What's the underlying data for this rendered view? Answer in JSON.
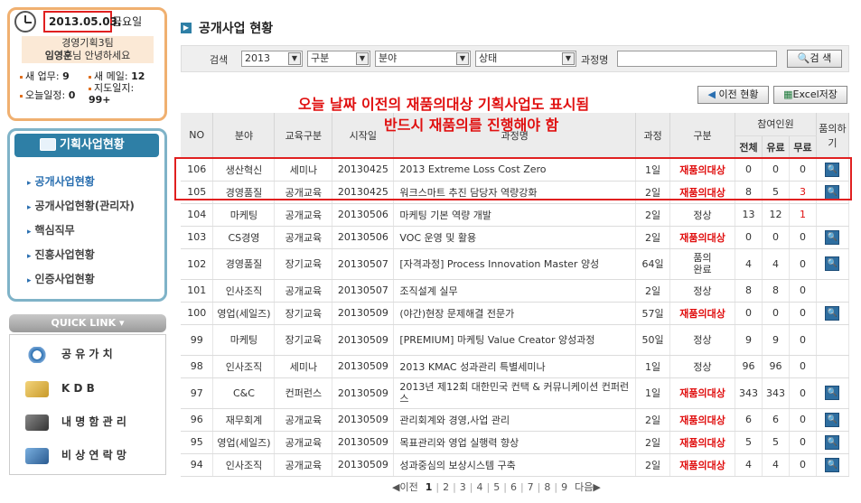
{
  "user": {
    "date": "2013.05.03.",
    "day_of_week": "금요일",
    "dept": "경영기획3팀",
    "name": "임영훈",
    "greeting": "님 안녕하세요",
    "new_tasks_label": "새 업무:",
    "new_tasks": "9",
    "new_mail_label": "새 메일:",
    "new_mail": "12",
    "today_label": "오늘일정:",
    "today": "0",
    "guide_label": "지도일지:",
    "guide": "99+"
  },
  "sidebar": {
    "header": "기획사업현황",
    "items": [
      {
        "label": "공개사업현황",
        "active": true
      },
      {
        "label": "공개사업현황(관리자)",
        "active": false
      },
      {
        "label": "핵심직무",
        "active": false
      },
      {
        "label": "진흥사업현황",
        "active": false
      },
      {
        "label": "인증사업현황",
        "active": false
      }
    ]
  },
  "quicklink": {
    "header": "QUICK LINK",
    "items": [
      {
        "label": "공 유 가 치",
        "icon": "shared-value-icon"
      },
      {
        "label": "K D B",
        "icon": "kdb-icon"
      },
      {
        "label": "내 명 함 관 리",
        "icon": "business-card-icon"
      },
      {
        "label": "비 상 연 락 망",
        "icon": "emergency-contact-icon"
      }
    ]
  },
  "main": {
    "title": "공개사업 현황",
    "search": {
      "label": "검색",
      "year": "2013",
      "category": "구분",
      "field": "분야",
      "status": "상태",
      "course_label": "과정명",
      "course_value": "",
      "search_button": "검 색"
    },
    "prev_button": "이전 현황",
    "excel_button": "Excel저장",
    "notice_line1": "오늘 날짜 이전의 재품의대상 기획사업도 표시됨",
    "notice_line2": "반드시 재품의를 진행해야 함",
    "table": {
      "headers": {
        "no": "NO",
        "field": "분야",
        "edu_type": "교육구분",
        "start": "시작일",
        "course": "과정명",
        "length": "과정",
        "category": "구분",
        "participants": "참여인원",
        "total": "전체",
        "paid": "유료",
        "free": "무료",
        "approval": "품의하기"
      },
      "rows": [
        {
          "no": "106",
          "field": "생산혁신",
          "edu": "세미나",
          "start": "20130425",
          "course": "2013 Extreme Loss Cost Zero",
          "len": "1일",
          "cat": "재품의대상",
          "total": "0",
          "paid": "0",
          "free": "0",
          "btn": true
        },
        {
          "no": "105",
          "field": "경영품질",
          "edu": "공개교육",
          "start": "20130425",
          "course": "워크스마트 추진 담당자 역량강화",
          "len": "2일",
          "cat": "재품의대상",
          "total": "8",
          "paid": "5",
          "free": "3",
          "btn": true
        },
        {
          "no": "104",
          "field": "마케팅",
          "edu": "공개교육",
          "start": "20130506",
          "course": "마케팅 기본 역량 개발",
          "len": "2일",
          "cat": "정상",
          "total": "13",
          "paid": "12",
          "free": "1",
          "btn": false
        },
        {
          "no": "103",
          "field": "CS경영",
          "edu": "공개교육",
          "start": "20130506",
          "course": "VOC 운영 및 활용",
          "len": "2일",
          "cat": "재품의대상",
          "total": "0",
          "paid": "0",
          "free": "0",
          "btn": true
        },
        {
          "no": "102",
          "field": "경영품질",
          "edu": "장기교육",
          "start": "20130507",
          "course": "[자격과정] Process Innovation Master 양성",
          "len": "64일",
          "cat": "품의\n완료",
          "total": "4",
          "paid": "4",
          "free": "0",
          "btn": true
        },
        {
          "no": "101",
          "field": "인사조직",
          "edu": "공개교육",
          "start": "20130507",
          "course": "조직설계 실무",
          "len": "2일",
          "cat": "정상",
          "total": "8",
          "paid": "8",
          "free": "0",
          "btn": false
        },
        {
          "no": "100",
          "field": "영업(세일즈)",
          "edu": "장기교육",
          "start": "20130509",
          "course": "(야간)현장 문제해결 전문가",
          "len": "57일",
          "cat": "재품의대상",
          "total": "0",
          "paid": "0",
          "free": "0",
          "btn": true
        },
        {
          "no": "99",
          "field": "마케팅",
          "edu": "장기교육",
          "start": "20130509",
          "course": "[PREMIUM] 마케팅 Value Creator 양성과정",
          "len": "50일",
          "cat": "정상",
          "total": "9",
          "paid": "9",
          "free": "0",
          "btn": false
        },
        {
          "no": "98",
          "field": "인사조직",
          "edu": "세미나",
          "start": "20130509",
          "course": "2013 KMAC 성과관리 특별세미나",
          "len": "1일",
          "cat": "정상",
          "total": "96",
          "paid": "96",
          "free": "0",
          "btn": false
        },
        {
          "no": "97",
          "field": "C&C",
          "edu": "컨퍼런스",
          "start": "20130509",
          "course": "2013년 제12회 대한민국 컨택 & 커뮤니케이션 컨퍼런스",
          "len": "1일",
          "cat": "재품의대상",
          "total": "343",
          "paid": "343",
          "free": "0",
          "btn": true
        },
        {
          "no": "96",
          "field": "재무회계",
          "edu": "공개교육",
          "start": "20130509",
          "course": "관리회계와 경영,사업 관리",
          "len": "2일",
          "cat": "재품의대상",
          "total": "6",
          "paid": "6",
          "free": "0",
          "btn": true
        },
        {
          "no": "95",
          "field": "영업(세일즈)",
          "edu": "공개교육",
          "start": "20130509",
          "course": "목표관리와 영업 실행력 향상",
          "len": "2일",
          "cat": "재품의대상",
          "total": "5",
          "paid": "5",
          "free": "0",
          "btn": true
        },
        {
          "no": "94",
          "field": "인사조직",
          "edu": "공개교육",
          "start": "20130509",
          "course": "성과중심의 보상시스템 구축",
          "len": "2일",
          "cat": "재품의대상",
          "total": "4",
          "paid": "4",
          "free": "0",
          "btn": true
        }
      ]
    },
    "pager": {
      "prev": "◀이전",
      "pages": [
        "1",
        "2",
        "3",
        "4",
        "5",
        "6",
        "7",
        "8",
        "9"
      ],
      "current": "1",
      "next": "다음▶"
    }
  },
  "colors": {
    "accent": "#2e7fa6",
    "alert": "#e01010",
    "user_border": "#f0b070"
  }
}
